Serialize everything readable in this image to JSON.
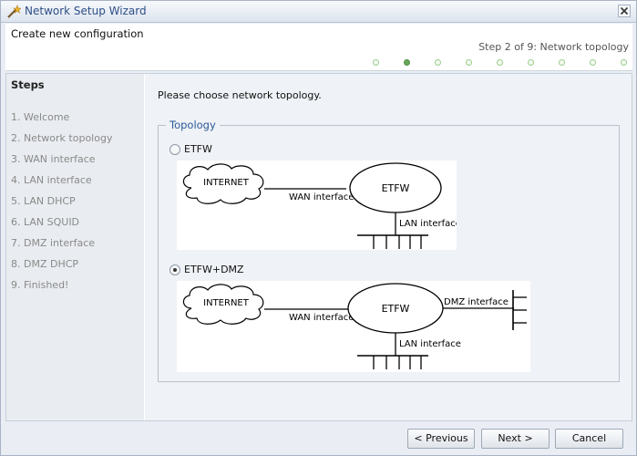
{
  "window": {
    "title": "Network Setup Wizard"
  },
  "header": {
    "title": "Create new configuration",
    "step_text": "Step 2 of 9: Network topology",
    "progress": {
      "total": 9,
      "current": 2
    }
  },
  "sidebar": {
    "title": "Steps",
    "items": [
      {
        "label": "1. Welcome"
      },
      {
        "label": "2. Network topology"
      },
      {
        "label": "3. WAN interface"
      },
      {
        "label": "4. LAN interface"
      },
      {
        "label": "5. LAN DHCP"
      },
      {
        "label": "6. LAN SQUID"
      },
      {
        "label": "7. DMZ interface"
      },
      {
        "label": "8. DMZ DHCP"
      },
      {
        "label": "9. Finished!"
      }
    ]
  },
  "main": {
    "instruction": "Please choose network topology.",
    "group_title": "Topology",
    "options": [
      {
        "label": "ETFW",
        "checked": false,
        "diagram": {
          "internet": "INTERNET",
          "wan": "WAN interface",
          "firewall": "ETFW",
          "lan": "LAN interface"
        }
      },
      {
        "label": "ETFW+DMZ",
        "checked": true,
        "diagram": {
          "internet": "INTERNET",
          "wan": "WAN interface",
          "firewall": "ETFW",
          "dmz": "DMZ interface",
          "lan": "LAN interface"
        }
      }
    ]
  },
  "buttons": {
    "previous": "< Previous",
    "next": "Next >",
    "cancel": "Cancel"
  },
  "colors": {
    "title_text": "#2d4f86",
    "legend_text": "#2d5a9a",
    "progress_active": "#68a85a"
  }
}
